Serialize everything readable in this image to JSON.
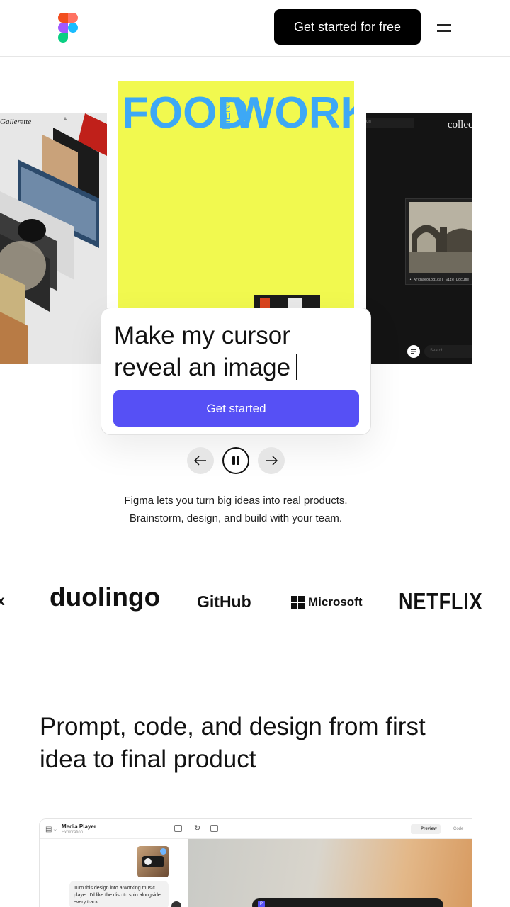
{
  "header": {
    "cta_label": "Get started for free",
    "logo_name": "figma-logo",
    "menu_icon": "hamburger-menu-icon"
  },
  "hero": {
    "left_card": {
      "title": "Gallerette",
      "corner_text": "A"
    },
    "center_card": {
      "headline_left": "FOOD",
      "headline_middle": "MENU",
      "headline_right": "WORKS"
    },
    "right_card": {
      "title": "collecti",
      "tag": "on",
      "caption": "• Archaeological Site Docume",
      "search_placeholder": "Search"
    },
    "prompt": {
      "text": "Make my cursor reveal an image",
      "button_label": "Get started"
    },
    "controls": {
      "prev_icon": "arrow-left-icon",
      "pause_icon": "pause-icon",
      "next_icon": "arrow-right-icon"
    },
    "tagline_line1": "Figma lets you turn big ideas into real products.",
    "tagline_line2": "Brainstorm, design, and build with your team."
  },
  "logos": {
    "partial": "x",
    "duolingo": "duolingo",
    "github": "GitHub",
    "microsoft": "Microsoft",
    "netflix": "NETFLIX"
  },
  "section": {
    "heading": "Prompt, code, and design from first idea to final product"
  },
  "app_mock": {
    "title": "Media Player",
    "subtitle": "Exploration",
    "preview_label": "Preview",
    "code_label": "Code",
    "message": "Turn this design into a working music player. I'd like the disc to spin alongside every track.",
    "player_letter": "P"
  },
  "colors": {
    "primary_button": "#5650f5",
    "black_button": "#000000",
    "menu_card_bg": "#f1f94f",
    "menu_text": "#3da8f5"
  }
}
